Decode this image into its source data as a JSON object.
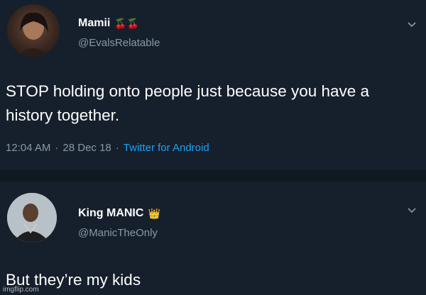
{
  "tweet1": {
    "display_name": "Mamii",
    "badge": "🍒🍒",
    "handle": "@EvalsRelatable",
    "text": "STOP holding onto people just because you have a history together.",
    "time": "12:04 AM",
    "date": "28 Dec 18",
    "client": "Twitter for Android"
  },
  "tweet2": {
    "display_name": "King MANIC",
    "badge": "👑",
    "handle": "@ManicTheOnly",
    "text": "But they’re my kids"
  },
  "watermark": "imgflip.com",
  "colors": {
    "background": "#16202c",
    "text": "#ffffff",
    "secondary": "#8899a6",
    "link": "#1da1f2"
  },
  "icons": {
    "more": "chevron-down-icon"
  }
}
